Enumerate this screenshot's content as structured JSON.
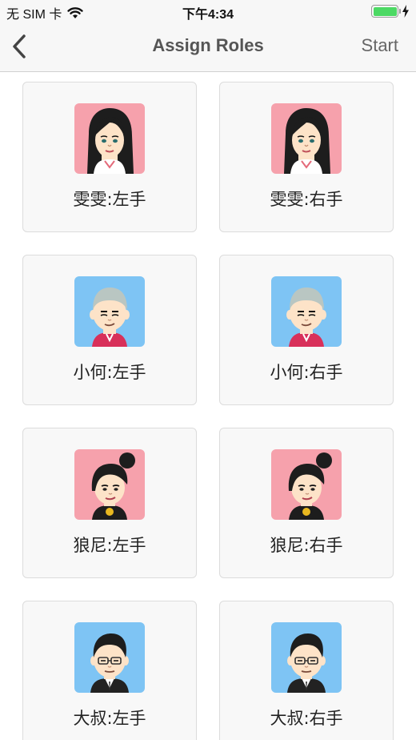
{
  "status_bar": {
    "carrier": "无 SIM 卡",
    "time": "下午4:34",
    "battery_level": 1.0,
    "battery_color": "#4cd964"
  },
  "nav": {
    "title": "Assign Roles",
    "back_icon": "chevron-left-icon",
    "start_label": "Start"
  },
  "roles": [
    {
      "label": "雯雯:左手",
      "avatar_bg": "#f6a1ac",
      "avatar": "girl-long-hair"
    },
    {
      "label": "雯雯:右手",
      "avatar_bg": "#f6a1ac",
      "avatar": "girl-long-hair"
    },
    {
      "label": "小何:左手",
      "avatar_bg": "#7ec4f4",
      "avatar": "boy-buzz-cut"
    },
    {
      "label": "小何:右手",
      "avatar_bg": "#7ec4f4",
      "avatar": "boy-buzz-cut"
    },
    {
      "label": "狼尼:左手",
      "avatar_bg": "#f6a1ac",
      "avatar": "girl-bun-hair"
    },
    {
      "label": "狼尼:右手",
      "avatar_bg": "#f6a1ac",
      "avatar": "girl-bun-hair"
    },
    {
      "label": "大叔:左手",
      "avatar_bg": "#7ec4f4",
      "avatar": "man-glasses"
    },
    {
      "label": "大叔:右手",
      "avatar_bg": "#7ec4f4",
      "avatar": "man-glasses"
    }
  ]
}
